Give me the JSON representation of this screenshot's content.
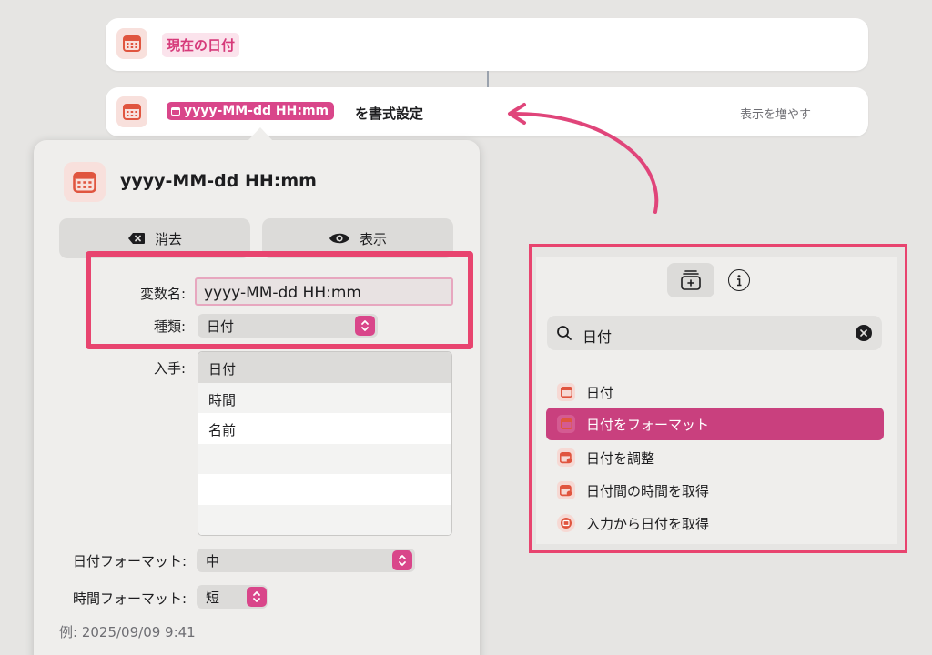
{
  "actions": {
    "current_date_label": "現在の日付",
    "format_token": "yyyy-MM-dd HH:mm",
    "format_suffix": "を書式設定",
    "show_more": "表示を増やす"
  },
  "popover": {
    "title": "yyyy-MM-dd HH:mm",
    "clear_button": "消去",
    "show_button": "表示",
    "variable_name_label": "変数名:",
    "variable_name_value": "yyyy-MM-dd HH:mm",
    "type_label": "種類:",
    "type_value": "日付",
    "get_label": "入手:",
    "get_options": [
      "日付",
      "時間",
      "名前",
      "",
      "",
      ""
    ],
    "date_format_label": "日付フォーマット:",
    "date_format_value": "中",
    "time_format_label": "時間フォーマット:",
    "time_format_value": "短",
    "example": "例: 2025/09/09 9:41"
  },
  "search_panel": {
    "query": "日付",
    "results": [
      {
        "label": "日付",
        "icon": "calendar-icon"
      },
      {
        "label": "日付をフォーマット",
        "icon": "calendar-icon"
      },
      {
        "label": "日付を調整",
        "icon": "calendar-adjust-icon"
      },
      {
        "label": "日付間の時間を取得",
        "icon": "calendar-clock-icon"
      },
      {
        "label": "入力から日付を取得",
        "icon": "calendar-circle-icon"
      }
    ],
    "selected_index": 1
  },
  "colors": {
    "accent_pink": "#d9468a",
    "highlight_red": "#e8446f",
    "selected_row": "#c9407e"
  }
}
